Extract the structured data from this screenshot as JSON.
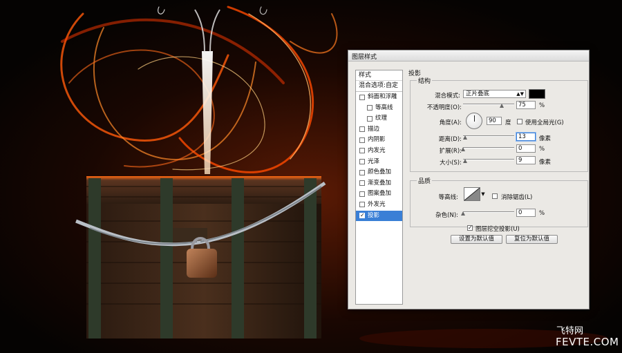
{
  "dialog": {
    "title": "图层样式",
    "styles_header": "样式",
    "blend_options": "混合选项:自定",
    "style_items": [
      {
        "label": "斜面和浮雕",
        "checked": false,
        "indent": false
      },
      {
        "label": "等高线",
        "checked": false,
        "indent": true
      },
      {
        "label": "纹理",
        "checked": false,
        "indent": true
      },
      {
        "label": "描边",
        "checked": false,
        "indent": false
      },
      {
        "label": "内阴影",
        "checked": false,
        "indent": false
      },
      {
        "label": "内发光",
        "checked": false,
        "indent": false
      },
      {
        "label": "光泽",
        "checked": false,
        "indent": false
      },
      {
        "label": "颜色叠加",
        "checked": false,
        "indent": false
      },
      {
        "label": "渐变叠加",
        "checked": false,
        "indent": false
      },
      {
        "label": "图案叠加",
        "checked": false,
        "indent": false
      },
      {
        "label": "外发光",
        "checked": false,
        "indent": false
      },
      {
        "label": "投影",
        "checked": true,
        "indent": false,
        "selected": true
      }
    ],
    "section_title": "投影",
    "structure": {
      "legend": "结构",
      "blend_mode_label": "混合模式:",
      "blend_mode_value": "正片叠底",
      "shadow_color": "#000000",
      "opacity_label": "不透明度(O):",
      "opacity_value": "75",
      "opacity_unit": "%",
      "opacity_level": 75,
      "angle_label": "角度(A):",
      "angle_value": "90",
      "angle_unit": "度",
      "global_light_label": "使用全局光(G)",
      "global_light_checked": false,
      "distance_label": "距离(D):",
      "distance_value": "13",
      "distance_unit": "像素",
      "distance_level": 4,
      "spread_label": "扩展(R):",
      "spread_value": "0",
      "spread_unit": "%",
      "spread_level": 0,
      "size_label": "大小(S):",
      "size_value": "9",
      "size_unit": "像素",
      "size_level": 4
    },
    "quality": {
      "legend": "品质",
      "contour_label": "等高线:",
      "antialias_label": "消除锯齿(L)",
      "antialias_checked": false,
      "noise_label": "杂色(N):",
      "noise_value": "0",
      "noise_unit": "%",
      "noise_level": 0
    },
    "knockout_label": "图层挖空投影(U)",
    "knockout_checked": true,
    "set_default_button": "设置为默认值",
    "reset_default_button": "复位为默认值"
  },
  "watermark": {
    "line1": "飞特网",
    "line2": "FEVTE.COM"
  },
  "colors": {
    "selection": "#3a7fd6",
    "dialog_bg": "#ebe9e5",
    "fire": "#ff5a0a"
  }
}
